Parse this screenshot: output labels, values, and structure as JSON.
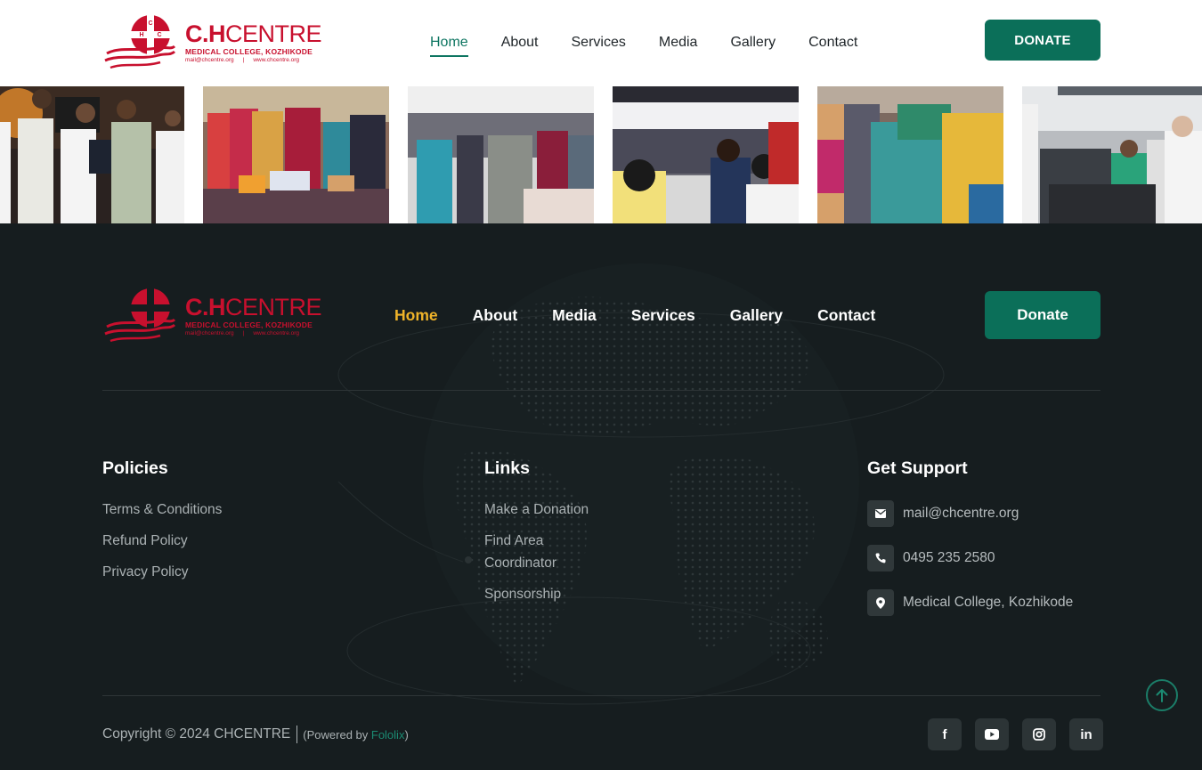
{
  "header": {
    "logo": {
      "name_bold": "C.H",
      "name_light": "CENTRE",
      "subtitle": "MEDICAL COLLEGE, KOZHIKODE",
      "email": "mail@chcentre.org",
      "separator": "|",
      "website": "www.chcentre.org",
      "emblem_letters": [
        "C",
        "H",
        "C"
      ],
      "brand_color": "#c8102e"
    },
    "nav": [
      {
        "label": "Home",
        "active": true
      },
      {
        "label": "About"
      },
      {
        "label": "Services"
      },
      {
        "label": "Media"
      },
      {
        "label": "Gallery"
      },
      {
        "label": "Contact"
      }
    ],
    "donate_label": "DONATE",
    "accent_color": "#0b6f59"
  },
  "gallery": {
    "images": [
      {
        "icon": "award-ceremony-photo"
      },
      {
        "icon": "women-at-stalls-photo"
      },
      {
        "icon": "dining-hall-women-photo"
      },
      {
        "icon": "dining-hall-crowd-photo"
      },
      {
        "icon": "crowd-women-photo"
      },
      {
        "icon": "kitchen-serving-photo"
      }
    ]
  },
  "footer": {
    "nav": [
      {
        "label": "Home",
        "active": true
      },
      {
        "label": "About"
      },
      {
        "label": "Media"
      },
      {
        "label": "Services"
      },
      {
        "label": "Gallery"
      },
      {
        "label": "Contact"
      }
    ],
    "donate_label": "Donate",
    "active_color": "#f0b429",
    "policies": {
      "title": "Policies",
      "items": [
        "Terms & Conditions",
        "Refund Policy",
        "Privacy Policy"
      ]
    },
    "links": {
      "title": "Links",
      "items": [
        "Make a Donation",
        "Find Area Coordinator",
        "Sponsorship"
      ]
    },
    "support": {
      "title": "Get Support",
      "items": [
        {
          "icon": "mail-icon",
          "text": "mail@chcentre.org"
        },
        {
          "icon": "phone-icon",
          "text": "0495 235 2580"
        },
        {
          "icon": "location-pin-icon",
          "text": "Medical College, Kozhikode"
        }
      ]
    },
    "copyright": {
      "text": "Copyright © 2024 CHCENTRE",
      "powered_prefix": "(Powered by ",
      "powered_brand": "Fololix",
      "powered_suffix": ")"
    },
    "socials": [
      {
        "icon": "facebook-icon",
        "glyph": "f"
      },
      {
        "icon": "youtube-icon"
      },
      {
        "icon": "instagram-icon"
      },
      {
        "icon": "linkedin-icon",
        "glyph": "in"
      }
    ],
    "scroll_top_icon": "arrow-up-icon"
  }
}
